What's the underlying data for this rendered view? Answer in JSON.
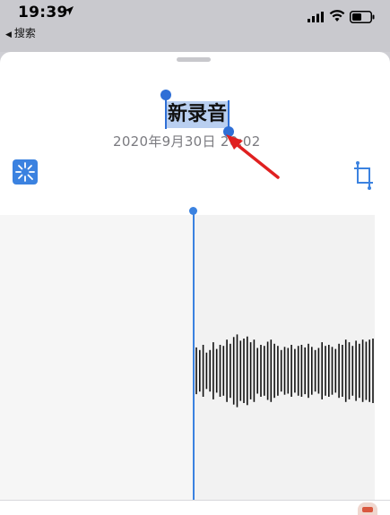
{
  "status_bar": {
    "time": "19:39",
    "back_label": "搜索"
  },
  "recording": {
    "title": "新录音",
    "date": "2020年9月30日 20:02"
  },
  "icons": {
    "enhance": "enhance-icon",
    "crop": "crop-icon",
    "location": "location-arrow-icon"
  },
  "colors": {
    "accent": "#3b82e0",
    "selection": "#b9cff0",
    "annotation_arrow": "#e02020"
  },
  "waveform": {
    "amplitudes": [
      0.45,
      0.4,
      0.5,
      0.35,
      0.4,
      0.55,
      0.42,
      0.5,
      0.48,
      0.6,
      0.52,
      0.65,
      0.7,
      0.58,
      0.62,
      0.66,
      0.55,
      0.6,
      0.44,
      0.5,
      0.48,
      0.56,
      0.6,
      0.52,
      0.48,
      0.4,
      0.46,
      0.44,
      0.5,
      0.42,
      0.48,
      0.5,
      0.45,
      0.52,
      0.46,
      0.4,
      0.44,
      0.55,
      0.48,
      0.5,
      0.46,
      0.42,
      0.52,
      0.5,
      0.6,
      0.55,
      0.48,
      0.58,
      0.52,
      0.6,
      0.56,
      0.6,
      0.62
    ]
  }
}
